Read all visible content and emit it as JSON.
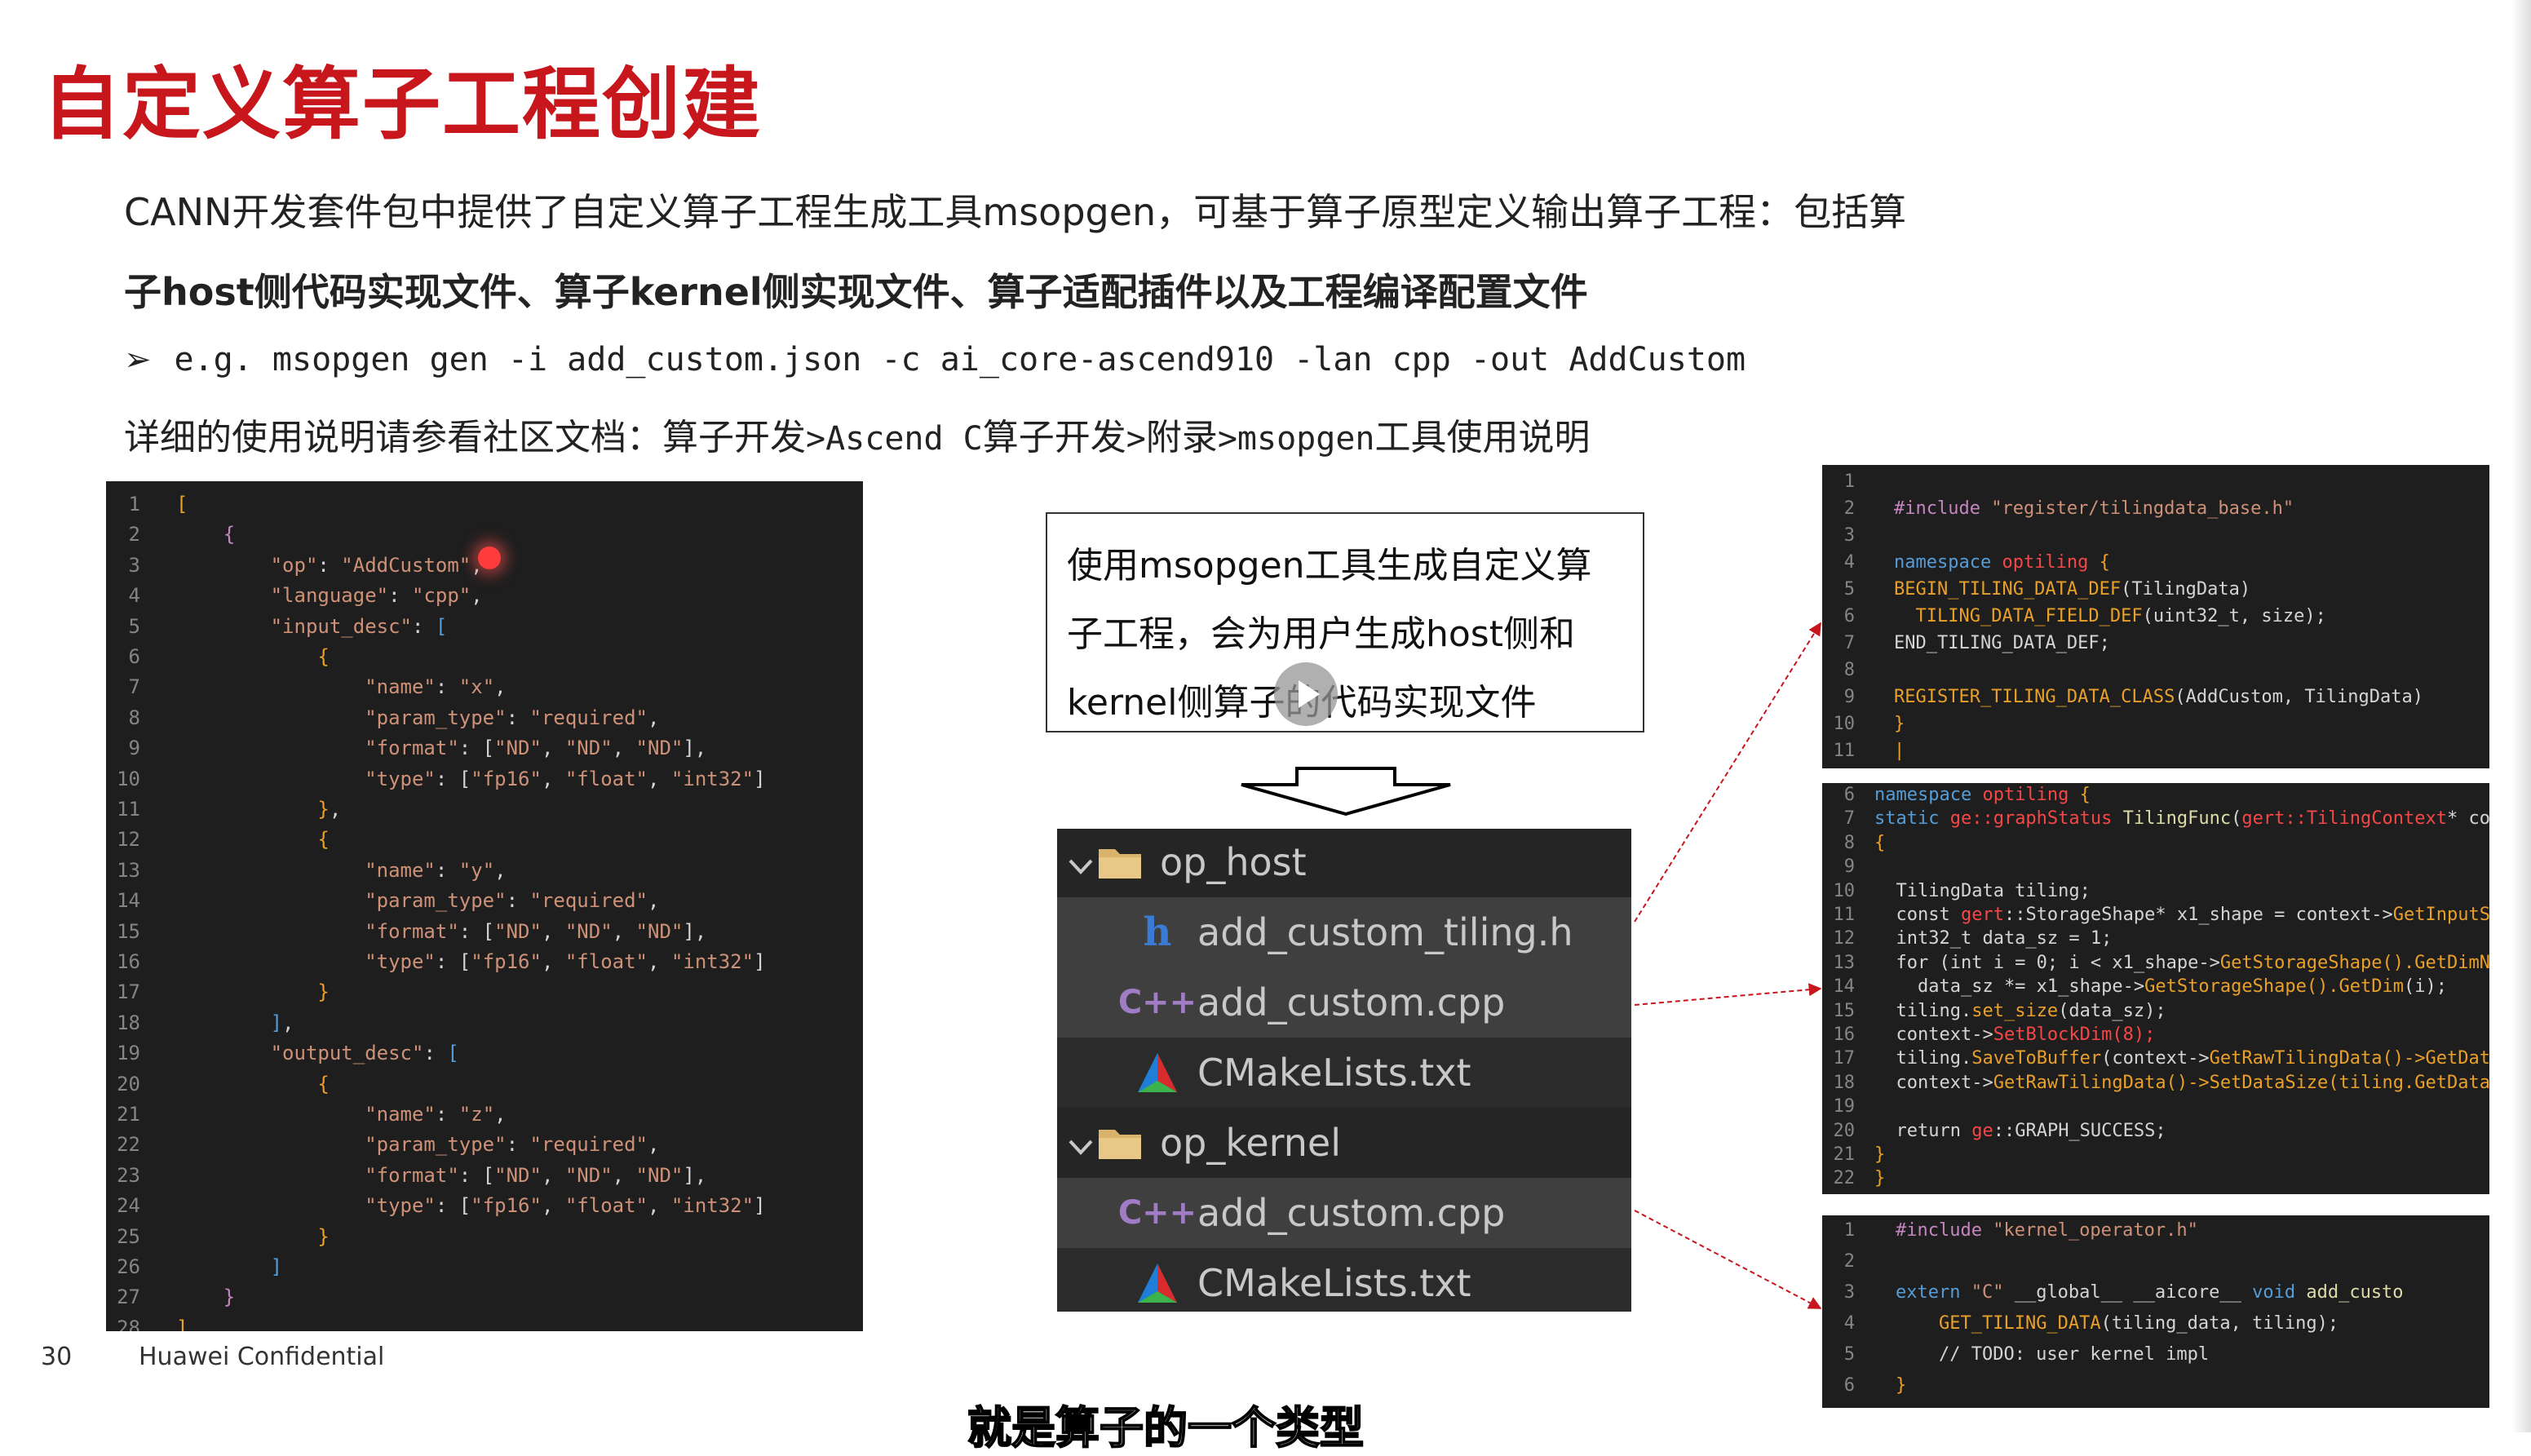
{
  "slide": {
    "title": "自定义算子工程创建",
    "para1": "CANN开发套件包中提供了自定义算子工程生成工具msopgen，可基于算子原型定义输出算子工程：包括算",
    "para2": "子host侧代码实现文件、算子kernel侧实现文件、算子适配插件以及工程编译配置文件",
    "para3_arrow": "➢",
    "para3": "e.g. msopgen gen -i add_custom.json -c ai_core-ascend910 -lan cpp -out AddCustom",
    "para4_a": "详细的使用说明请参看社区文档：算子开发",
    "para4_b": ">Ascend C",
    "para4_c": "算子开发",
    "para4_d": ">",
    "para4_e": "附录",
    "para4_f": ">msopgen",
    "para4_g": "工具使用说明",
    "callout": [
      "使用msopgen工具生成自定义算",
      "子工程，会为用户生成host侧和",
      "kernel侧算子的代码实现文件"
    ],
    "page_number": "30",
    "confidential": "Huawei Confidential",
    "subtitle": "就是算子的一个类型"
  },
  "file_tree": [
    {
      "label": "op_host",
      "icon": "folder-icon",
      "kind": "folder"
    },
    {
      "label": "add_custom_tiling.h",
      "icon": "header-file-icon",
      "kind": "file",
      "selected": true
    },
    {
      "label": "add_custom.cpp",
      "icon": "cpp-file-icon",
      "kind": "file",
      "selected": true
    },
    {
      "label": "CMakeLists.txt",
      "icon": "cmake-icon",
      "kind": "file"
    },
    {
      "label": "op_kernel",
      "icon": "folder-icon",
      "kind": "folder"
    },
    {
      "label": "add_custom.cpp",
      "icon": "cpp-file-icon",
      "kind": "file",
      "selected": true
    },
    {
      "label": "CMakeLists.txt",
      "icon": "cmake-icon",
      "kind": "file"
    }
  ],
  "json_code": [
    [
      {
        "c": "o",
        "t": "["
      }
    ],
    [
      {
        "c": "w",
        "t": "    "
      },
      {
        "c": "p",
        "t": "{"
      }
    ],
    [
      {
        "c": "w",
        "t": "        "
      },
      {
        "c": "k",
        "t": "\"op\""
      },
      {
        "c": "w",
        "t": ": "
      },
      {
        "c": "s",
        "t": "\"AddCustom\""
      },
      {
        "c": "w",
        "t": ","
      }
    ],
    [
      {
        "c": "w",
        "t": "        "
      },
      {
        "c": "k",
        "t": "\"language\""
      },
      {
        "c": "w",
        "t": ": "
      },
      {
        "c": "s",
        "t": "\"cpp\""
      },
      {
        "c": "w",
        "t": ","
      }
    ],
    [
      {
        "c": "w",
        "t": "        "
      },
      {
        "c": "k",
        "t": "\"input_desc\""
      },
      {
        "c": "w",
        "t": ": "
      },
      {
        "c": "m",
        "t": "["
      }
    ],
    [
      {
        "c": "w",
        "t": "            "
      },
      {
        "c": "o",
        "t": "{"
      }
    ],
    [
      {
        "c": "w",
        "t": "                "
      },
      {
        "c": "k",
        "t": "\"name\""
      },
      {
        "c": "w",
        "t": ": "
      },
      {
        "c": "s",
        "t": "\"x\""
      },
      {
        "c": "w",
        "t": ","
      }
    ],
    [
      {
        "c": "w",
        "t": "                "
      },
      {
        "c": "k",
        "t": "\"param_type\""
      },
      {
        "c": "w",
        "t": ": "
      },
      {
        "c": "s",
        "t": "\"required\""
      },
      {
        "c": "w",
        "t": ","
      }
    ],
    [
      {
        "c": "w",
        "t": "                "
      },
      {
        "c": "k",
        "t": "\"format\""
      },
      {
        "c": "w",
        "t": ": ["
      },
      {
        "c": "s",
        "t": "\"ND\""
      },
      {
        "c": "w",
        "t": ", "
      },
      {
        "c": "s",
        "t": "\"ND\""
      },
      {
        "c": "w",
        "t": ", "
      },
      {
        "c": "s",
        "t": "\"ND\""
      },
      {
        "c": "w",
        "t": "],"
      }
    ],
    [
      {
        "c": "w",
        "t": "                "
      },
      {
        "c": "k",
        "t": "\"type\""
      },
      {
        "c": "w",
        "t": ": ["
      },
      {
        "c": "s",
        "t": "\"fp16\""
      },
      {
        "c": "w",
        "t": ", "
      },
      {
        "c": "s",
        "t": "\"float\""
      },
      {
        "c": "w",
        "t": ", "
      },
      {
        "c": "s",
        "t": "\"int32\""
      },
      {
        "c": "w",
        "t": "]"
      }
    ],
    [
      {
        "c": "w",
        "t": "            "
      },
      {
        "c": "o",
        "t": "}"
      },
      {
        "c": "w",
        "t": ","
      }
    ],
    [
      {
        "c": "w",
        "t": "            "
      },
      {
        "c": "o",
        "t": "{"
      }
    ],
    [
      {
        "c": "w",
        "t": "                "
      },
      {
        "c": "k",
        "t": "\"name\""
      },
      {
        "c": "w",
        "t": ": "
      },
      {
        "c": "s",
        "t": "\"y\""
      },
      {
        "c": "w",
        "t": ","
      }
    ],
    [
      {
        "c": "w",
        "t": "                "
      },
      {
        "c": "k",
        "t": "\"param_type\""
      },
      {
        "c": "w",
        "t": ": "
      },
      {
        "c": "s",
        "t": "\"required\""
      },
      {
        "c": "w",
        "t": ","
      }
    ],
    [
      {
        "c": "w",
        "t": "                "
      },
      {
        "c": "k",
        "t": "\"format\""
      },
      {
        "c": "w",
        "t": ": ["
      },
      {
        "c": "s",
        "t": "\"ND\""
      },
      {
        "c": "w",
        "t": ", "
      },
      {
        "c": "s",
        "t": "\"ND\""
      },
      {
        "c": "w",
        "t": ", "
      },
      {
        "c": "s",
        "t": "\"ND\""
      },
      {
        "c": "w",
        "t": "],"
      }
    ],
    [
      {
        "c": "w",
        "t": "                "
      },
      {
        "c": "k",
        "t": "\"type\""
      },
      {
        "c": "w",
        "t": ": ["
      },
      {
        "c": "s",
        "t": "\"fp16\""
      },
      {
        "c": "w",
        "t": ", "
      },
      {
        "c": "s",
        "t": "\"float\""
      },
      {
        "c": "w",
        "t": ", "
      },
      {
        "c": "s",
        "t": "\"int32\""
      },
      {
        "c": "w",
        "t": "]"
      }
    ],
    [
      {
        "c": "w",
        "t": "            "
      },
      {
        "c": "o",
        "t": "}"
      }
    ],
    [
      {
        "c": "w",
        "t": "        "
      },
      {
        "c": "m",
        "t": "]"
      },
      {
        "c": "w",
        "t": ","
      }
    ],
    [
      {
        "c": "w",
        "t": "        "
      },
      {
        "c": "k",
        "t": "\"output_desc\""
      },
      {
        "c": "w",
        "t": ": "
      },
      {
        "c": "m",
        "t": "["
      }
    ],
    [
      {
        "c": "w",
        "t": "            "
      },
      {
        "c": "o",
        "t": "{"
      }
    ],
    [
      {
        "c": "w",
        "t": "                "
      },
      {
        "c": "k",
        "t": "\"name\""
      },
      {
        "c": "w",
        "t": ": "
      },
      {
        "c": "s",
        "t": "\"z\""
      },
      {
        "c": "w",
        "t": ","
      }
    ],
    [
      {
        "c": "w",
        "t": "                "
      },
      {
        "c": "k",
        "t": "\"param_type\""
      },
      {
        "c": "w",
        "t": ": "
      },
      {
        "c": "s",
        "t": "\"required\""
      },
      {
        "c": "w",
        "t": ","
      }
    ],
    [
      {
        "c": "w",
        "t": "                "
      },
      {
        "c": "k",
        "t": "\"format\""
      },
      {
        "c": "w",
        "t": ": ["
      },
      {
        "c": "s",
        "t": "\"ND\""
      },
      {
        "c": "w",
        "t": ", "
      },
      {
        "c": "s",
        "t": "\"ND\""
      },
      {
        "c": "w",
        "t": ", "
      },
      {
        "c": "s",
        "t": "\"ND\""
      },
      {
        "c": "w",
        "t": "],"
      }
    ],
    [
      {
        "c": "w",
        "t": "                "
      },
      {
        "c": "k",
        "t": "\"type\""
      },
      {
        "c": "w",
        "t": ": ["
      },
      {
        "c": "s",
        "t": "\"fp16\""
      },
      {
        "c": "w",
        "t": ", "
      },
      {
        "c": "s",
        "t": "\"float\""
      },
      {
        "c": "w",
        "t": ", "
      },
      {
        "c": "s",
        "t": "\"int32\""
      },
      {
        "c": "w",
        "t": "]"
      }
    ],
    [
      {
        "c": "w",
        "t": "            "
      },
      {
        "c": "o",
        "t": "}"
      }
    ],
    [
      {
        "c": "w",
        "t": "        "
      },
      {
        "c": "m",
        "t": "]"
      }
    ],
    [
      {
        "c": "w",
        "t": "    "
      },
      {
        "c": "p",
        "t": "}"
      }
    ],
    [
      {
        "c": "o",
        "t": "]"
      }
    ]
  ],
  "tiling_h_code": [
    [],
    [
      {
        "c": "p",
        "t": "#include "
      },
      {
        "c": "s",
        "t": "\"register/tilingdata_base.h\""
      }
    ],
    [],
    [
      {
        "c": "m",
        "t": "namespace "
      },
      {
        "c": "r",
        "t": "optiling "
      },
      {
        "c": "o",
        "t": "{"
      }
    ],
    [
      {
        "c": "o",
        "t": "BEGIN_TILING_DATA_DEF"
      },
      {
        "c": "w",
        "t": "(TilingData)"
      }
    ],
    [
      {
        "c": "w",
        "t": "  "
      },
      {
        "c": "o",
        "t": "TILING_DATA_FIELD_DEF"
      },
      {
        "c": "w",
        "t": "(uint32_t, size);"
      }
    ],
    [
      {
        "c": "w",
        "t": "END_TILING_DATA_DEF;"
      }
    ],
    [],
    [
      {
        "c": "o",
        "t": "REGISTER_TILING_DATA_CLASS"
      },
      {
        "c": "w",
        "t": "(AddCustom, TilingData)"
      }
    ],
    [
      {
        "c": "o",
        "t": "}"
      }
    ],
    [
      {
        "c": "o",
        "t": "|"
      }
    ]
  ],
  "tiling_cpp_code": [
    [
      {
        "c": "m",
        "t": "namespace "
      },
      {
        "c": "r",
        "t": "optiling "
      },
      {
        "c": "o",
        "t": "{"
      }
    ],
    [
      {
        "c": "m",
        "t": "static "
      },
      {
        "c": "r",
        "t": "ge::graphStatus "
      },
      {
        "c": "f",
        "t": "TilingFunc"
      },
      {
        "c": "w",
        "t": "("
      },
      {
        "c": "r",
        "t": "gert::TilingContext"
      },
      {
        "c": "w",
        "t": "* context"
      }
    ],
    [
      {
        "c": "o",
        "t": "{"
      }
    ],
    [],
    [
      {
        "c": "w",
        "t": "  TilingData tiling;"
      }
    ],
    [
      {
        "c": "w",
        "t": "  const "
      },
      {
        "c": "r",
        "t": "gert"
      },
      {
        "c": "w",
        "t": "::StorageShape* x1_shape = context->"
      },
      {
        "c": "o",
        "t": "GetInputShape("
      }
    ],
    [
      {
        "c": "w",
        "t": "  int32_t data_sz = 1;"
      }
    ],
    [
      {
        "c": "w",
        "t": "  for (int i = 0; i < x1_shape->"
      },
      {
        "c": "o",
        "t": "GetStorageShape().GetDimNum();"
      }
    ],
    [
      {
        "c": "w",
        "t": "    data_sz *= x1_shape->"
      },
      {
        "c": "o",
        "t": "GetStorageShape().GetDim"
      },
      {
        "c": "w",
        "t": "(i);"
      }
    ],
    [
      {
        "c": "w",
        "t": "  tiling."
      },
      {
        "c": "o",
        "t": "set_size"
      },
      {
        "c": "w",
        "t": "(data_sz);"
      }
    ],
    [
      {
        "c": "w",
        "t": "  context->"
      },
      {
        "c": "r",
        "t": "SetBlockDim(8);"
      }
    ],
    [
      {
        "c": "w",
        "t": "  tiling."
      },
      {
        "c": "o",
        "t": "SaveToBuffer"
      },
      {
        "c": "w",
        "t": "(context->"
      },
      {
        "c": "o",
        "t": "GetRawTilingData()->GetData(),"
      }
    ],
    [
      {
        "c": "w",
        "t": "  context->"
      },
      {
        "c": "o",
        "t": "GetRawTilingData()->SetDataSize(tiling.GetDataSize("
      }
    ],
    [],
    [
      {
        "c": "w",
        "t": "  return "
      },
      {
        "c": "r",
        "t": "ge"
      },
      {
        "c": "w",
        "t": "::GRAPH_SUCCESS;"
      }
    ],
    [
      {
        "c": "o",
        "t": "}"
      }
    ],
    [
      {
        "c": "o",
        "t": "}"
      }
    ]
  ],
  "kernel_cpp_code": [
    [
      {
        "c": "p",
        "t": "#include "
      },
      {
        "c": "s",
        "t": "\"kernel_operator.h\""
      }
    ],
    [],
    [
      {
        "c": "m",
        "t": "extern "
      },
      {
        "c": "s",
        "t": "\"C\" "
      },
      {
        "c": "w",
        "t": "__global__ __aicore__ "
      },
      {
        "c": "m",
        "t": "void "
      },
      {
        "c": "f",
        "t": "add_custo"
      }
    ],
    [
      {
        "c": "w",
        "t": "    "
      },
      {
        "c": "o",
        "t": "GET_TILING_DATA"
      },
      {
        "c": "w",
        "t": "(tiling_data, tiling);"
      }
    ],
    [
      {
        "c": "w",
        "t": "    // TODO: user kernel impl"
      }
    ],
    [
      {
        "c": "o",
        "t": "}"
      }
    ]
  ]
}
